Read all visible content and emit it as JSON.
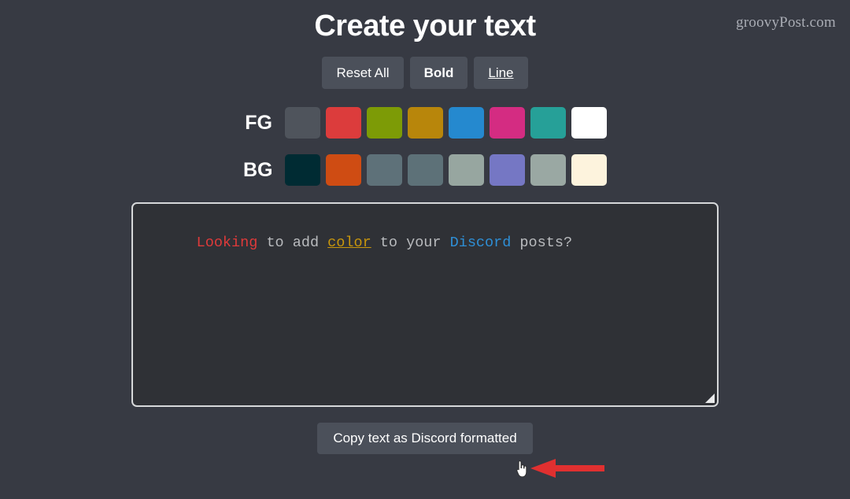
{
  "page": {
    "background_color": "#373a43",
    "watermark": "groovyPost.com",
    "title": "Create your text"
  },
  "toolbar": {
    "buttons": [
      {
        "label": "Reset All",
        "style": "normal",
        "name": "reset-all-button"
      },
      {
        "label": "Bold",
        "style": "bold",
        "name": "bold-button"
      },
      {
        "label": "Line",
        "style": "underline",
        "name": "line-button"
      }
    ]
  },
  "foreground": {
    "label": "FG",
    "swatches": [
      {
        "name": "fg-swatch-dark-gray",
        "color": "#4f545c"
      },
      {
        "name": "fg-swatch-red",
        "color": "#dc3c3c"
      },
      {
        "name": "fg-swatch-olive",
        "color": "#7d9b06"
      },
      {
        "name": "fg-swatch-gold",
        "color": "#b8860b"
      },
      {
        "name": "fg-swatch-blue",
        "color": "#2589cf"
      },
      {
        "name": "fg-swatch-pink",
        "color": "#d42c82"
      },
      {
        "name": "fg-swatch-teal",
        "color": "#26a098"
      },
      {
        "name": "fg-swatch-white",
        "color": "#ffffff"
      }
    ]
  },
  "background": {
    "label": "BG",
    "swatches": [
      {
        "name": "bg-swatch-dark-teal",
        "color": "#002b33"
      },
      {
        "name": "bg-swatch-orange",
        "color": "#cf4c13"
      },
      {
        "name": "bg-swatch-slate-blue",
        "color": "#5e7179"
      },
      {
        "name": "bg-swatch-slate-gray",
        "color": "#5d7178"
      },
      {
        "name": "bg-swatch-gray-green",
        "color": "#97a6a0"
      },
      {
        "name": "bg-swatch-periwinkle",
        "color": "#7577c4"
      },
      {
        "name": "bg-swatch-sage",
        "color": "#9aa8a3"
      },
      {
        "name": "bg-swatch-cream",
        "color": "#fdf3dd"
      }
    ]
  },
  "editor": {
    "background_color": "#2f3136",
    "border_color": "#d6d8da",
    "tokens": [
      {
        "text": "Looking",
        "class": "tok-red",
        "color": "#e03a3a",
        "underline": false
      },
      {
        "text": " to add ",
        "class": "tok-plain",
        "color": "#b9bbbe",
        "underline": false
      },
      {
        "text": "color",
        "class": "tok-gold",
        "color": "#c8960c",
        "underline": true
      },
      {
        "text": " to your ",
        "class": "tok-plain",
        "color": "#b9bbbe",
        "underline": false
      },
      {
        "text": "Discord",
        "class": "tok-blue",
        "color": "#2e8fd6",
        "underline": false
      },
      {
        "text": " posts?",
        "class": "tok-plain",
        "color": "#b9bbbe",
        "underline": false
      }
    ]
  },
  "copy": {
    "label": "Copy text as Discord formatted"
  },
  "annotation": {
    "arrow_color": "#e03030",
    "direction": "left"
  }
}
